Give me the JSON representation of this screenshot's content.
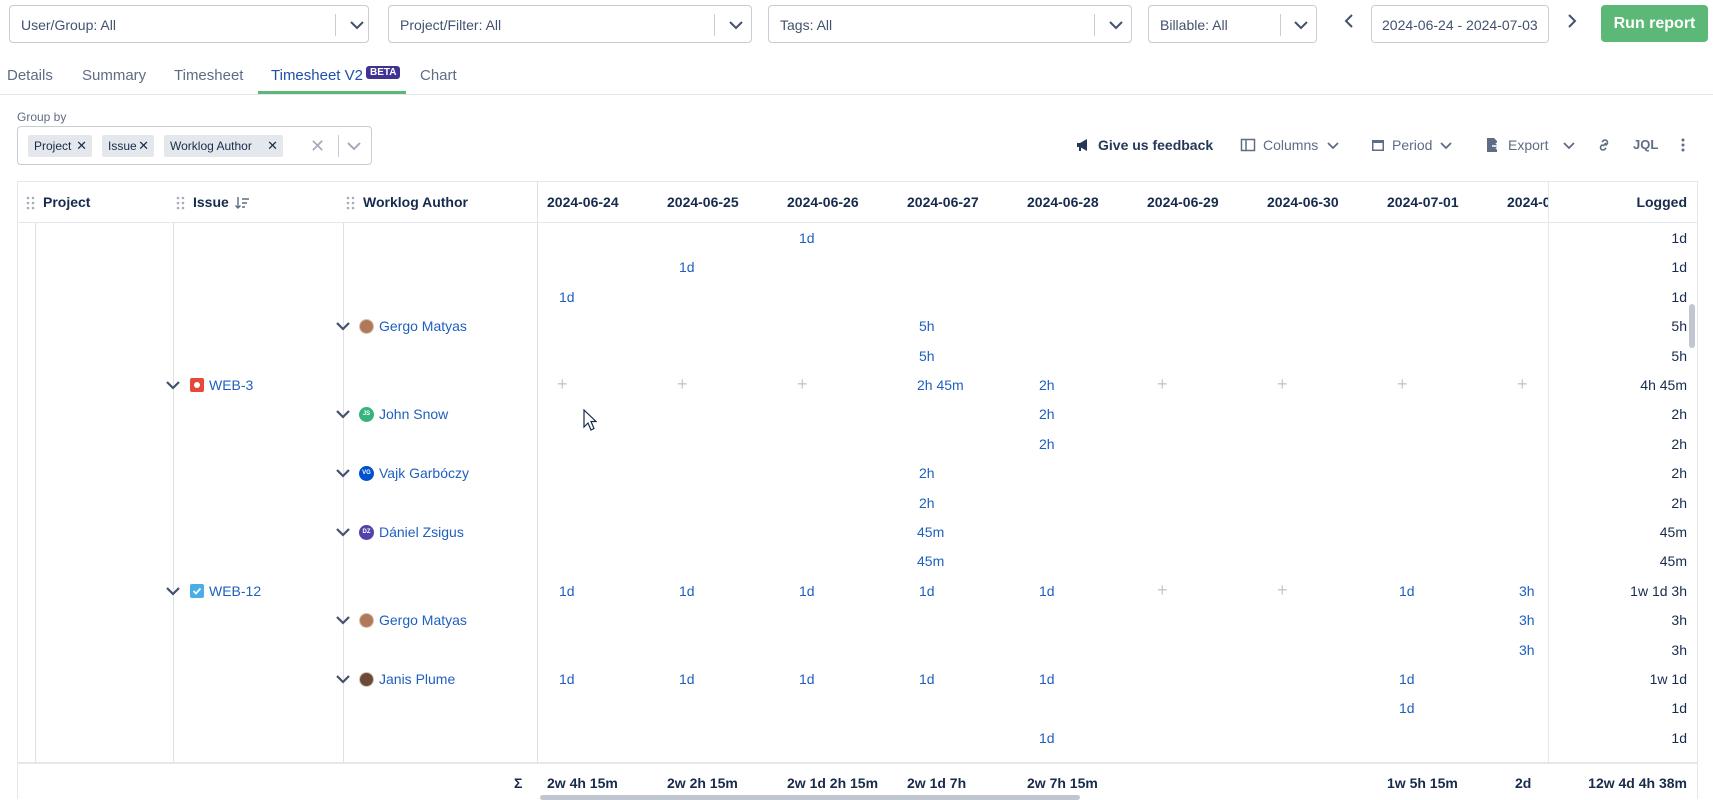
{
  "filters": {
    "user_group": "User/Group: All",
    "project_filter": "Project/Filter: All",
    "tags": "Tags: All",
    "billable": "Billable: All",
    "date_range": "2024-06-24 - 2024-07-03",
    "run_report": "Run report"
  },
  "tabs": [
    {
      "label": "Details"
    },
    {
      "label": "Summary"
    },
    {
      "label": "Timesheet"
    },
    {
      "label": "Timesheet V2",
      "badge": "BETA"
    },
    {
      "label": "Chart"
    }
  ],
  "group_by": {
    "label": "Group by",
    "chips": [
      "Project",
      "Issue",
      "Worklog Author"
    ]
  },
  "toolbar": {
    "feedback": "Give us feedback",
    "columns": "Columns",
    "period": "Period",
    "export": "Export",
    "jql": "JQL"
  },
  "grid": {
    "headers": {
      "project": "Project",
      "issue": "Issue",
      "author": "Worklog Author",
      "logged": "Logged"
    },
    "dates": [
      "2024-06-24",
      "2024-06-25",
      "2024-06-26",
      "2024-06-27",
      "2024-06-28",
      "2024-06-29",
      "2024-06-30",
      "2024-07-01",
      "2024-0"
    ],
    "rows": [
      {
        "kind": "worklog",
        "cells": [
          "",
          "",
          "1d",
          "",
          "",
          "",
          "",
          "",
          ""
        ],
        "logged": "1d"
      },
      {
        "kind": "worklog",
        "cells": [
          "",
          "1d",
          "",
          "",
          "",
          "",
          "",
          "",
          ""
        ],
        "logged": "1d"
      },
      {
        "kind": "worklog",
        "cells": [
          "1d",
          "",
          "",
          "",
          "",
          "",
          "",
          "",
          ""
        ],
        "logged": "1d"
      },
      {
        "kind": "author",
        "name": "Gergo Matyas",
        "avatar": "photo",
        "cells": [
          "",
          "",
          "",
          "5h",
          "",
          "",
          "",
          "",
          ""
        ],
        "logged": "5h"
      },
      {
        "kind": "worklog",
        "cells": [
          "",
          "",
          "",
          "5h",
          "",
          "",
          "",
          "",
          ""
        ],
        "logged": "5h"
      },
      {
        "kind": "issue",
        "key": "WEB-3",
        "icon": "bug",
        "cells": [
          "+",
          "+",
          "+",
          "2h 45m",
          "2h",
          "+",
          "+",
          "+",
          "+"
        ],
        "logged": "4h 45m"
      },
      {
        "kind": "author",
        "name": "John Snow",
        "avatar": "JS",
        "avatar_color": "#36b37e",
        "cells": [
          "",
          "",
          "",
          "",
          "2h",
          "",
          "",
          "",
          ""
        ],
        "logged": "2h"
      },
      {
        "kind": "worklog",
        "cells": [
          "",
          "",
          "",
          "",
          "2h",
          "",
          "",
          "",
          ""
        ],
        "logged": "2h"
      },
      {
        "kind": "author",
        "name": "Vajk Garbóczy",
        "avatar": "VG",
        "avatar_color": "#0052cc",
        "cells": [
          "",
          "",
          "",
          "2h",
          "",
          "",
          "",
          "",
          ""
        ],
        "logged": "2h"
      },
      {
        "kind": "worklog",
        "cells": [
          "",
          "",
          "",
          "2h",
          "",
          "",
          "",
          "",
          ""
        ],
        "logged": "2h"
      },
      {
        "kind": "author",
        "name": "Dániel Zsigus",
        "avatar": "DZ",
        "avatar_color": "#5243aa",
        "cells": [
          "",
          "",
          "",
          "45m",
          "",
          "",
          "",
          "",
          ""
        ],
        "logged": "45m"
      },
      {
        "kind": "worklog",
        "cells": [
          "",
          "",
          "",
          "45m",
          "",
          "",
          "",
          "",
          ""
        ],
        "logged": "45m"
      },
      {
        "kind": "issue",
        "key": "WEB-12",
        "icon": "task",
        "cells": [
          "1d",
          "1d",
          "1d",
          "1d",
          "1d",
          "+",
          "+",
          "1d",
          "3h"
        ],
        "logged": "1w 1d 3h"
      },
      {
        "kind": "author",
        "name": "Gergo Matyas",
        "avatar": "photo",
        "cells": [
          "",
          "",
          "",
          "",
          "",
          "",
          "",
          "",
          "3h"
        ],
        "logged": "3h"
      },
      {
        "kind": "worklog",
        "cells": [
          "",
          "",
          "",
          "",
          "",
          "",
          "",
          "",
          "3h"
        ],
        "logged": "3h"
      },
      {
        "kind": "author",
        "name": "Janis Plume",
        "avatar": "photo2",
        "cells": [
          "1d",
          "1d",
          "1d",
          "1d",
          "1d",
          "",
          "",
          "1d",
          ""
        ],
        "logged": "1w 1d"
      },
      {
        "kind": "worklog",
        "cells": [
          "",
          "",
          "",
          "",
          "",
          "",
          "",
          "1d",
          ""
        ],
        "logged": "1d"
      },
      {
        "kind": "worklog",
        "cells": [
          "",
          "",
          "",
          "",
          "1d",
          "",
          "",
          "",
          ""
        ],
        "logged": "1d"
      }
    ],
    "footer": {
      "sigma": "Σ",
      "totals": [
        "2w 4h 15m",
        "2w 2h 15m",
        "2w 1d 2h 15m",
        "2w 1d 7h",
        "2w 7h 15m",
        "",
        "",
        "1w 5h 15m",
        "2d"
      ],
      "logged": "12w 4d 4h 38m"
    }
  },
  "colors": {
    "accent": "#5cb876",
    "link": "#1f5fbf",
    "beta": "#403294"
  }
}
